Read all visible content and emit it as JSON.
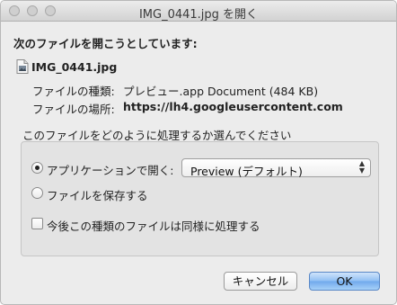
{
  "window": {
    "title": "IMG_0441.jpg を開く"
  },
  "dialog": {
    "heading": "次のファイルを開こうとしています:",
    "file_name": "IMG_0441.jpg",
    "type_label": "ファイルの種類:",
    "type_value": "プレビュー.app Document (484 KB)",
    "location_label": "ファイルの場所:",
    "location_value": "https://lh4.googleusercontent.com",
    "question": "このファイルをどのように処理するか選んでください",
    "open_with_label": "アプリケーションで開く:",
    "open_with_app": "Preview (デフォルト)",
    "save_label": "ファイルを保存する",
    "remember_label": "今後この種類のファイルは同様に処理する",
    "open_with_selected": true,
    "remember_checked": false
  },
  "buttons": {
    "cancel": "キャンセル",
    "ok": "OK"
  }
}
